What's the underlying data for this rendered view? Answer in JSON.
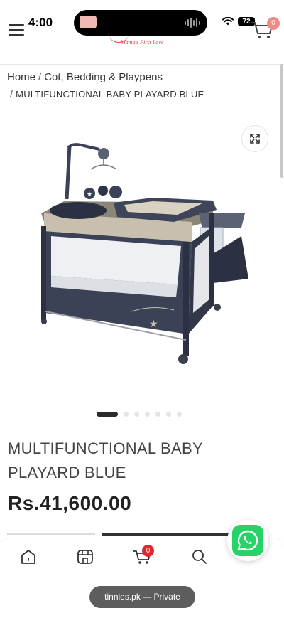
{
  "status_bar": {
    "time": "4:00",
    "battery": "72"
  },
  "header": {
    "logo_tagline": "Mama's First Love",
    "cart_count": "0"
  },
  "breadcrumb": {
    "home": "Home",
    "separator": "/",
    "category": "Cot, Bedding & Playpens",
    "current": "MULTIFUNCTIONAL BABY PLAYARD BLUE"
  },
  "gallery": {
    "slide_count": 7,
    "active_index": 0
  },
  "product": {
    "title": "MULTIFUNCTIONAL BABY PLAYARD BLUE",
    "price": "Rs.41,600.00"
  },
  "bottom_nav": {
    "cart_count": "0"
  },
  "browser": {
    "url_label": "tinnies.pk — Private"
  },
  "colors": {
    "accent_red": "#e0262f",
    "price_text": "#222222",
    "whatsapp_green": "#25d366",
    "playard_navy": "#3b4256"
  }
}
